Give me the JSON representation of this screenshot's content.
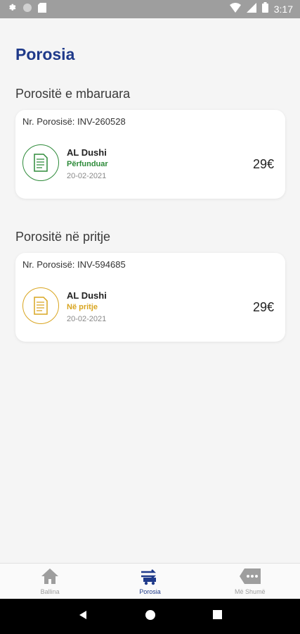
{
  "status_bar": {
    "time": "3:17",
    "icons": [
      "gear-icon",
      "circle-icon",
      "sd-card-icon",
      "wifi-icon",
      "signal-icon",
      "battery-icon"
    ]
  },
  "page": {
    "title": "Porosia"
  },
  "sections": [
    {
      "title": "Porositë e mbaruara",
      "orders": [
        {
          "invoice": "Nr. Porosisë: INV-260528",
          "merchant": "AL Dushi",
          "status": "Përfunduar",
          "date": "20-02-2021",
          "price": "29€",
          "status_color": "#2e8b3a",
          "icon": "document-icon"
        }
      ]
    },
    {
      "title": "Porositë në pritje",
      "orders": [
        {
          "invoice": "Nr. Porosisë: INV-594685",
          "merchant": "AL Dushi",
          "status": "Në pritje",
          "date": "20-02-2021",
          "price": "29€",
          "status_color": "#d9a520",
          "icon": "document-icon"
        }
      ]
    }
  ],
  "bottom_nav": {
    "items": [
      {
        "label": "Ballina",
        "icon": "home-icon",
        "active": false
      },
      {
        "label": "Porosia",
        "icon": "orders-icon",
        "active": true
      },
      {
        "label": "Më Shumë",
        "icon": "more-icon",
        "active": false
      }
    ]
  },
  "system_nav": {
    "icons": [
      "back-icon",
      "home-circle-icon",
      "recents-icon"
    ]
  },
  "colors": {
    "primary": "#1f3a8a",
    "done": "#2e8b3a",
    "pending": "#d9a520",
    "background": "#f5f5f5"
  }
}
